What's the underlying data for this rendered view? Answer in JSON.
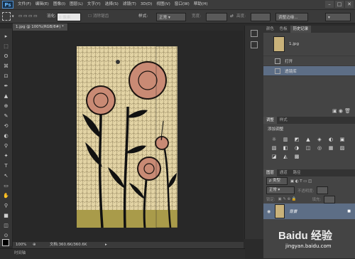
{
  "app": {
    "logo": "Ps"
  },
  "menu": [
    "文件(F)",
    "编辑(E)",
    "图像(I)",
    "图层(L)",
    "文字(Y)",
    "选择(S)",
    "滤镜(T)",
    "3D(D)",
    "视图(V)",
    "窗口(W)",
    "帮助(H)"
  ],
  "window_buttons": [
    "–",
    "□",
    "✕"
  ],
  "options": {
    "feather_label": "羽化:",
    "feather_value": "0 像素",
    "antialias_label": "消除锯齿",
    "style_label": "样式:",
    "style_value": "正常",
    "width_label": "宽度:",
    "height_label": "高度:",
    "refine_edge": "调整边缘..."
  },
  "document": {
    "tab_label": "1.jpg @ 100%(RGB/8#) *"
  },
  "status": {
    "zoom": "100%",
    "doc_info": "文档:360.6K/360.6K"
  },
  "timeline": {
    "label": "时间轴"
  },
  "history_panel": {
    "tabs": [
      "颜色",
      "色板",
      "历史记录"
    ],
    "snapshot": "1.jpg",
    "states": [
      "打开",
      "透镜库"
    ]
  },
  "adjustments_panel": {
    "tabs": [
      "调整",
      "样式"
    ],
    "title": "添加调整",
    "icons": [
      "☼",
      "▥",
      "◩",
      "▲",
      "◈",
      "◐",
      "▣",
      "▧",
      "◧",
      "◑",
      "◫",
      "◎",
      "▦",
      "▨",
      "◪",
      "◭",
      "▩"
    ]
  },
  "layers_panel": {
    "tabs": [
      "图层",
      "通道",
      "路径"
    ],
    "kind_label": "ρ 类型",
    "blend_mode": "正常",
    "opacity_label": "不透明度:",
    "lock_label": "锁定:",
    "fill_label": "填充:",
    "layer_name": "背景",
    "lock_icon": "🔒"
  },
  "tools": [
    "▸",
    "⬚",
    "ʘ",
    "⌘",
    "⊡",
    "✒",
    "▲",
    "⊕",
    "✎",
    "⟲",
    "◐",
    "⚲",
    "✦",
    "T",
    "↖",
    "▭",
    "✋",
    "⚲",
    "■",
    "◫",
    "⊙"
  ],
  "watermark": {
    "text": "Baidu 经验",
    "url": "jingyan.baidu.com"
  }
}
